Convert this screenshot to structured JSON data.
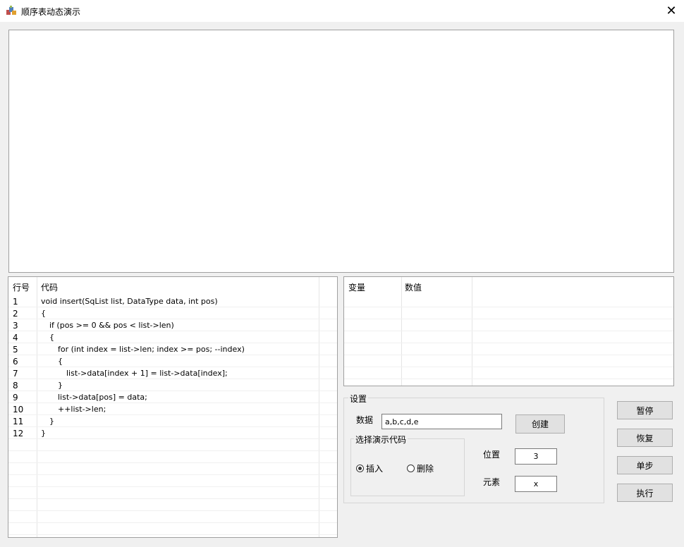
{
  "window": {
    "title": "顺序表动态演示",
    "close_glyph": "✕"
  },
  "code_list": {
    "headers": [
      "行号",
      "代码"
    ],
    "rows": [
      {
        "line": "1",
        "code": "void insert(SqList list, DataType data, int pos)",
        "indent": 0
      },
      {
        "line": "2",
        "code": "{",
        "indent": 0
      },
      {
        "line": "3",
        "code": "if (pos >= 0 && pos < list->len)",
        "indent": 1
      },
      {
        "line": "4",
        "code": "{",
        "indent": 1
      },
      {
        "line": "5",
        "code": "for (int index = list->len; index >= pos; --index)",
        "indent": 2
      },
      {
        "line": "6",
        "code": "{",
        "indent": 2
      },
      {
        "line": "7",
        "code": "list->data[index + 1] = list->data[index];",
        "indent": 3
      },
      {
        "line": "8",
        "code": "}",
        "indent": 2
      },
      {
        "line": "9",
        "code": "list->data[pos] = data;",
        "indent": 2
      },
      {
        "line": "10",
        "code": "++list->len;",
        "indent": 2
      },
      {
        "line": "11",
        "code": "}",
        "indent": 1
      },
      {
        "line": "12",
        "code": "}",
        "indent": 0
      }
    ]
  },
  "var_list": {
    "headers": [
      "变量",
      "数值"
    ]
  },
  "settings": {
    "title": "设置",
    "data_label": "数据",
    "data_value": "a,b,c,d,e",
    "create_label": "创建",
    "demo_group_title": "选择演示代码",
    "radio_insert": "插入",
    "radio_delete": "删除",
    "selected": "insert",
    "position_label": "位置",
    "position_value": "3",
    "element_label": "元素",
    "element_value": "x"
  },
  "controls": {
    "pause": "暂停",
    "resume": "恢复",
    "step": "单步",
    "execute": "执行"
  }
}
